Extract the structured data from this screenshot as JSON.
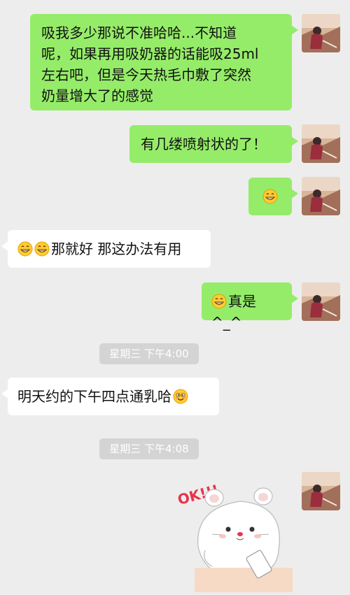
{
  "messages": [
    {
      "side": "me",
      "text": "吸我多少那说不准哈哈…不知道呢，如果再用吸奶器的话能吸25ml左右吧，但是今天热毛巾敷了突然奶量增大了的感觉"
    },
    {
      "side": "me",
      "text": "有几缕喷射状的了！"
    },
    {
      "side": "me",
      "emoji": "grin-emoji"
    },
    {
      "side": "them",
      "text": "那就好 那这办法有用",
      "emoji": "grin-emoji"
    },
    {
      "side": "me",
      "text": "真是^_^",
      "emoji": "grin-emoji"
    },
    {
      "side": "them",
      "text": "明天约的下午四点通乳哈",
      "emoji": "wink-emoji"
    },
    {
      "side": "me",
      "sticker": "ok-hamster-sticker"
    }
  ],
  "timestamps": {
    "t1": "星期三 下午4:00",
    "t2": "星期三 下午4:08"
  },
  "lines": {
    "m1_l1": "吸我多少那说不准哈哈...不知道",
    "m1_l2": "呢，如果再用吸奶器的话能吸25ml",
    "m1_l3": "左右吧，但是今天热毛巾敷了突然",
    "m1_l4": "奶量增大了的感觉",
    "m2": "有几缕喷射状的了！",
    "m4": "那就好 那这办法有用",
    "m5": "真是^_^",
    "m6": "明天约的下午四点通乳哈"
  },
  "sticker": {
    "text": "OK!!!"
  },
  "colors": {
    "background": "#ededed",
    "my_bubble": "#95ec69",
    "their_bubble": "#ffffff"
  }
}
